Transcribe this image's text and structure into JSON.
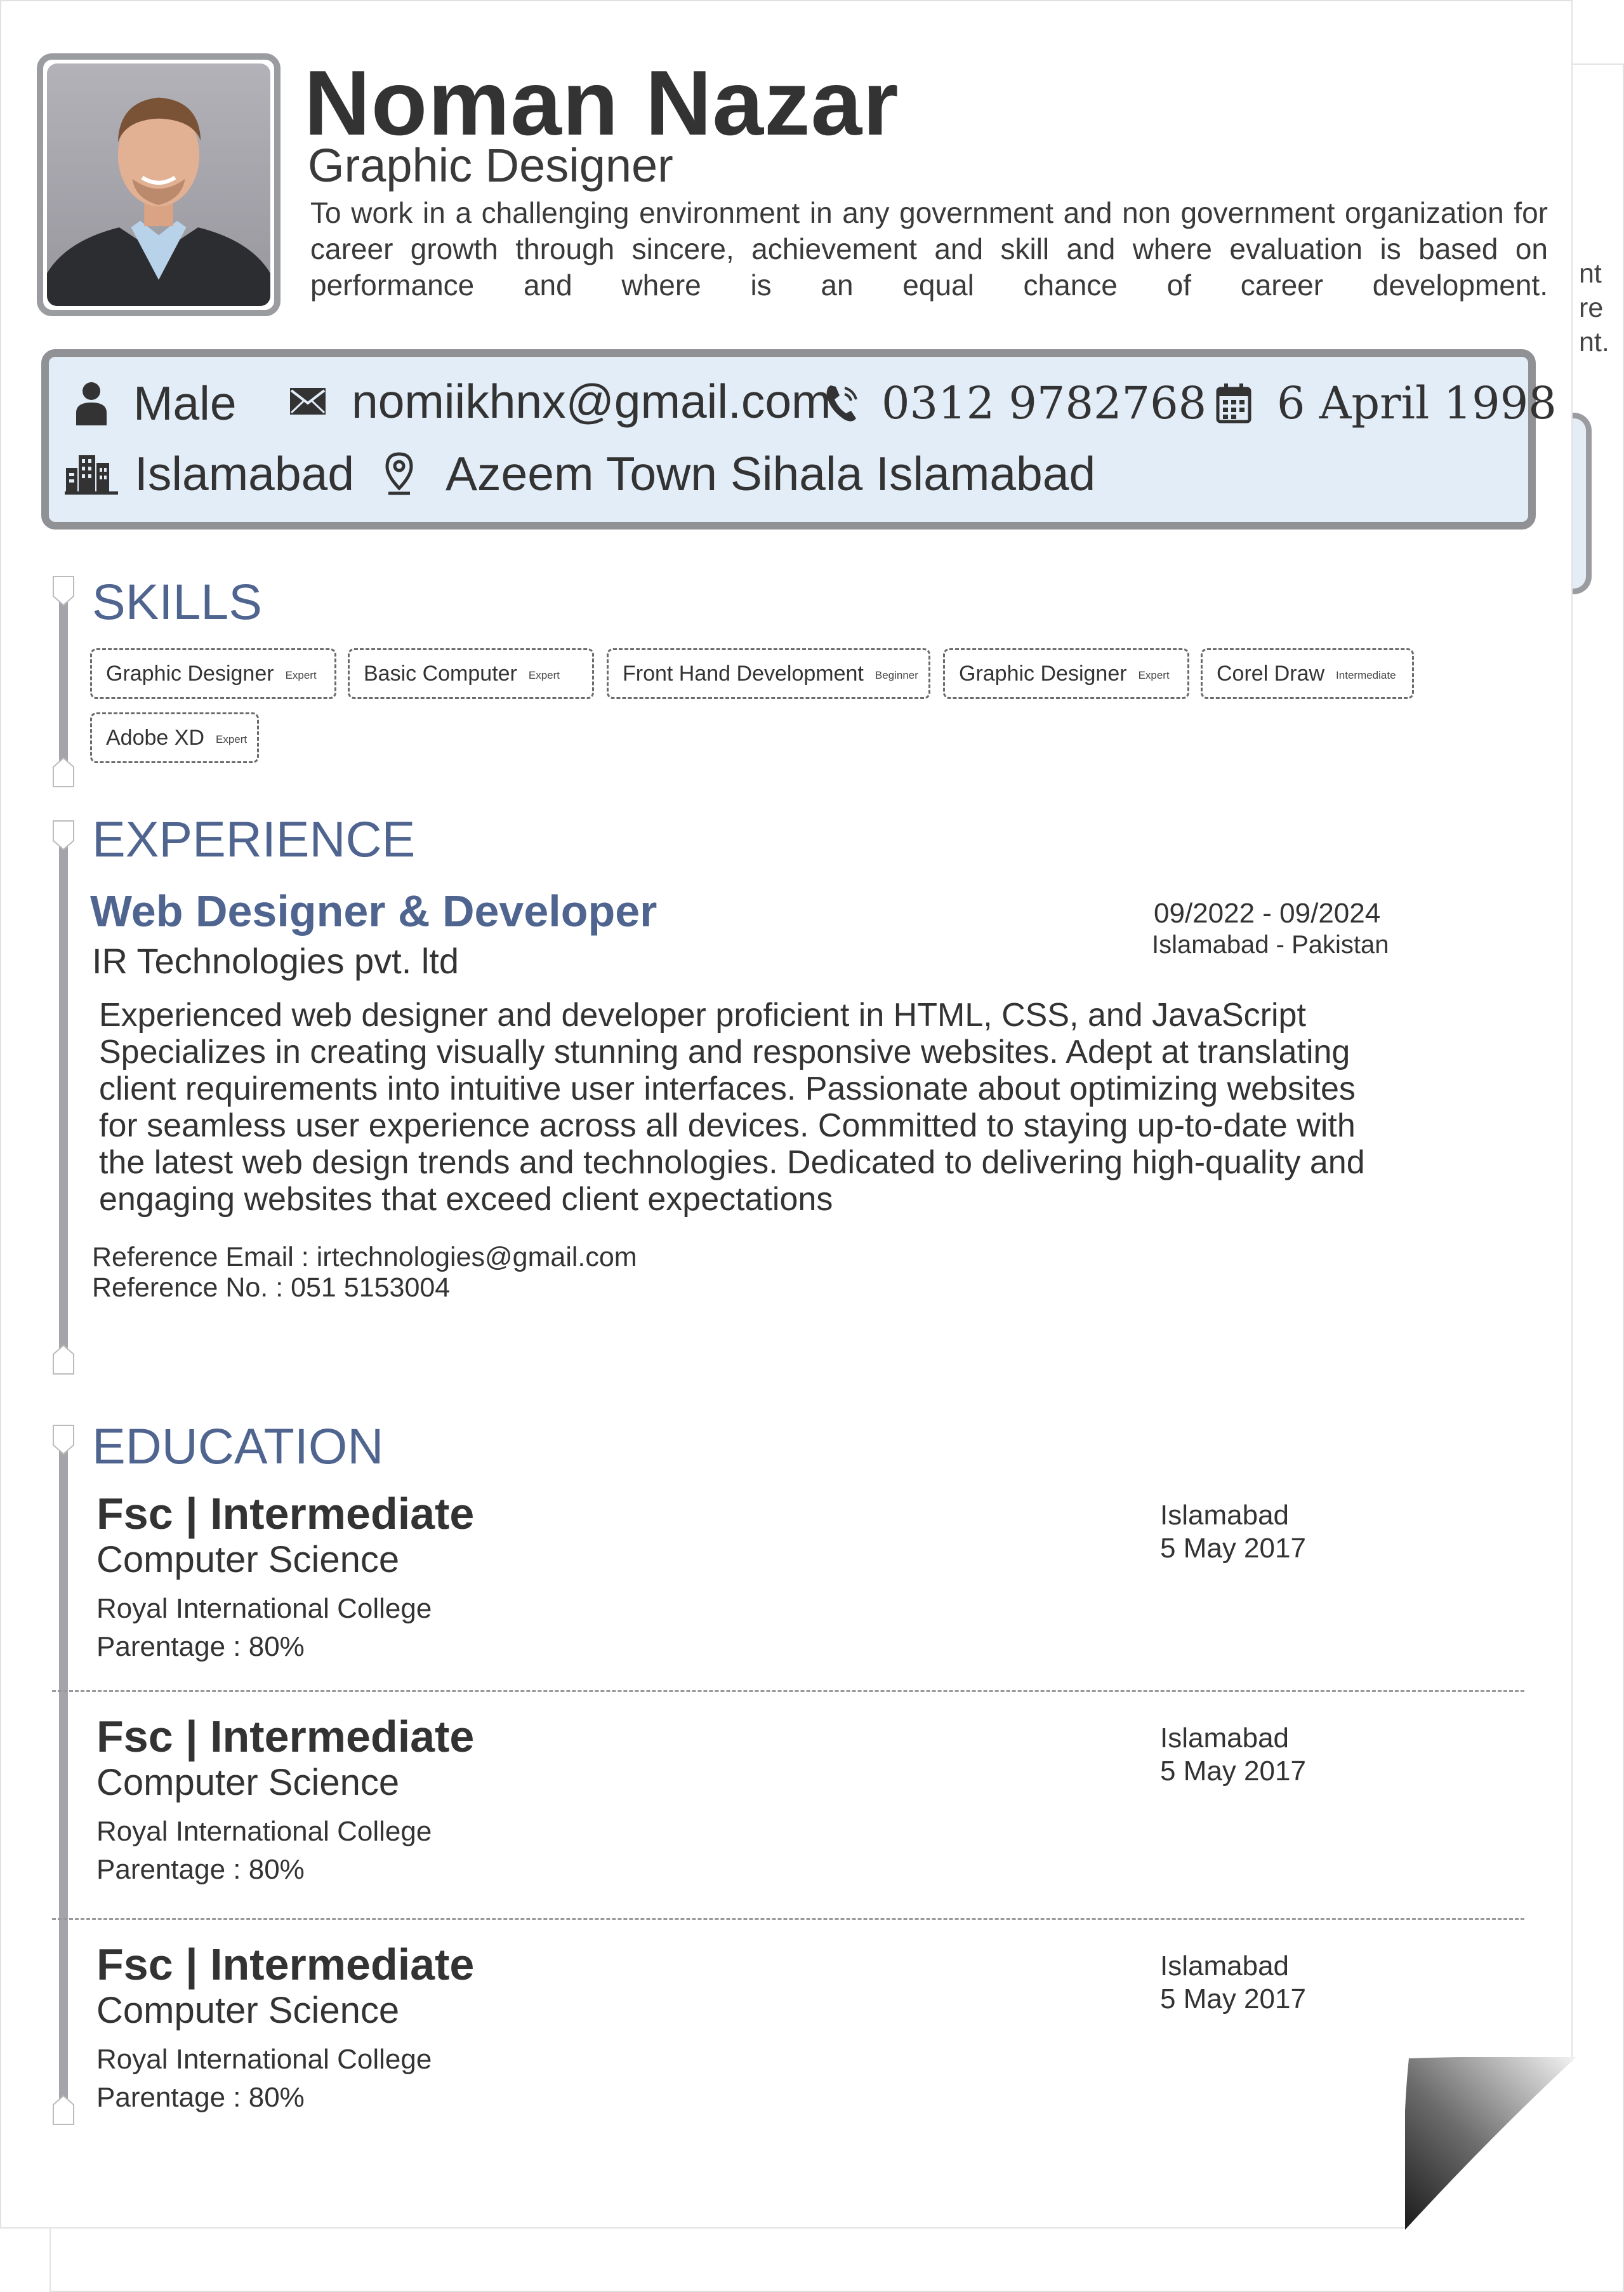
{
  "profile": {
    "name": "Noman Nazar",
    "title": "Graphic Designer",
    "objective": "To work in a challenging environment in any government and non government organization for career growth through sincere, achievement and skill and where evaluation is based on performance and where is an equal chance of career development.",
    "photo_alt": "profile photo"
  },
  "back_page": {
    "lines": [
      "nt",
      "re",
      "nt."
    ]
  },
  "contact": {
    "gender": "Male",
    "email": "nomiikhnx@gmail.com",
    "phone": "0312 9782768",
    "dob": "6 April 1998",
    "city": "Islamabad",
    "address": "Azeem Town Sihala Islamabad"
  },
  "skills": {
    "heading": "SKILLS",
    "items": [
      {
        "name": "Graphic Designer",
        "level": "Expert"
      },
      {
        "name": "Basic Computer",
        "level": "Expert"
      },
      {
        "name": "Front Hand Development",
        "level": "Beginner"
      },
      {
        "name": "Graphic Designer",
        "level": "Expert"
      },
      {
        "name": "Corel Draw",
        "level": "Intermediate"
      },
      {
        "name": "Adobe XD",
        "level": "Expert"
      }
    ]
  },
  "experience": {
    "heading": "EXPERIENCE",
    "job_title": "Web Designer & Developer",
    "company": "IR Technologies pvt. ltd",
    "dates": "09/2022 - 09/2024",
    "location": "Islamabad - Pakistan",
    "description_lines": [
      "Experienced web designer and developer proficient in  HTML, CSS, and JavaScript",
      "Specializes in creating  visually stunning and responsive websites. Adept at translating",
      "client requirements into intuitive user interfaces. Passionate about optimizing websites",
      "for seamless user experience across all devices. Committed to staying up-to-date with",
      "the latest web design trends and technologies. Dedicated to delivering high-quality and",
      "engaging websites that exceed client expectations"
    ],
    "reference_email": "Reference Email : irtechnologies@gmail.com",
    "reference_no": "Reference No. : 051 5153004"
  },
  "education": {
    "heading": "EDUCATION",
    "items": [
      {
        "degree": "Fsc | Intermediate",
        "field": "Computer Science",
        "school": "Royal International College",
        "score": "Parentage : 80%",
        "city": "Islamabad",
        "date": "5 May 2017"
      },
      {
        "degree": "Fsc | Intermediate",
        "field": "Computer Science",
        "school": "Royal International College",
        "score": "Parentage : 80%",
        "city": "Islamabad",
        "date": "5 May 2017"
      },
      {
        "degree": "Fsc | Intermediate",
        "field": "Computer Science",
        "school": "Royal International College",
        "score": "Parentage : 80%",
        "city": "Islamabad",
        "date": "5 May 2017"
      }
    ]
  },
  "colors": {
    "accent": "#4f6590",
    "contact_bg": "#e3edf8",
    "frame": "#9a9ca0",
    "text": "#333333"
  },
  "icons": [
    "user-icon",
    "envelope-icon",
    "phone-icon",
    "calendar-icon",
    "city-icon",
    "location-pin-icon"
  ]
}
